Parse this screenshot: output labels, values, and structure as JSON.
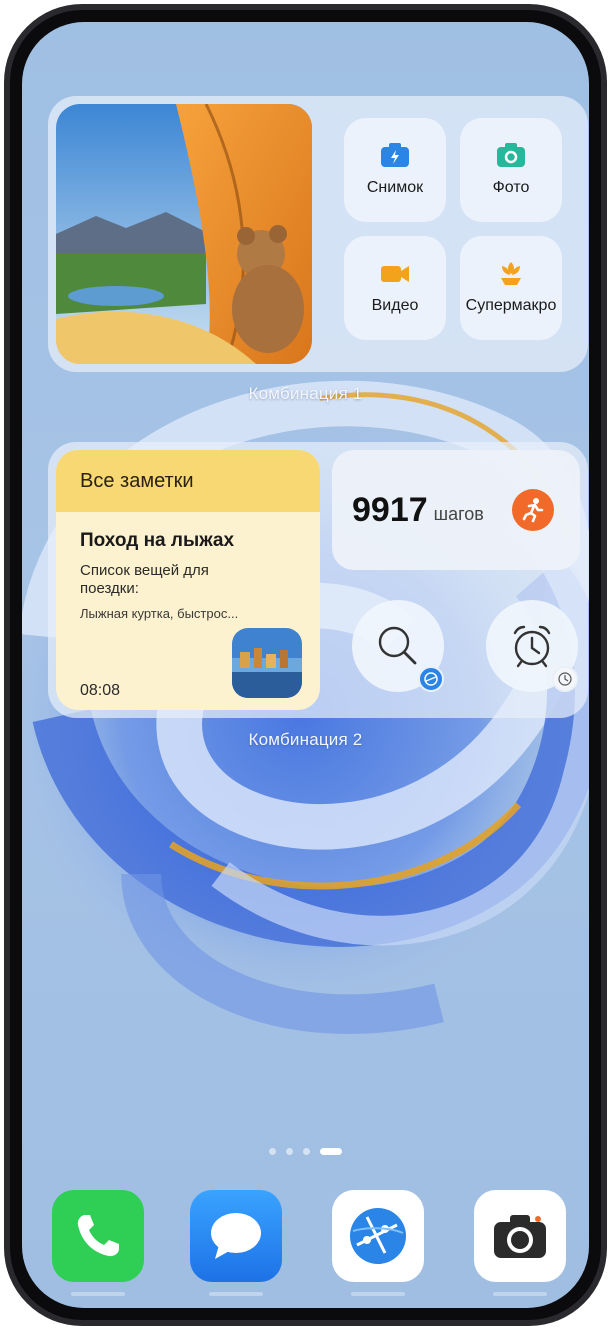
{
  "combo1": {
    "label": "Комбинация 1",
    "buttons": [
      {
        "label": "Снимок",
        "icon": "camera-bolt-icon"
      },
      {
        "label": "Фото",
        "icon": "photo-camera-icon"
      },
      {
        "label": "Видео",
        "icon": "video-camera-icon"
      },
      {
        "label": "Супермакро",
        "icon": "flower-macro-icon"
      }
    ]
  },
  "combo2": {
    "label": "Комбинация 2",
    "notes": {
      "header": "Все заметки",
      "title": "Поход на лыжах",
      "subtitle": "Список вещей для поездки:",
      "line": "Лыжная куртка, быстрос...",
      "time": "08:08"
    },
    "steps": {
      "value": "9917",
      "unit": "шагов",
      "icon": "running-person-icon"
    },
    "tools": [
      {
        "icon": "search-icon",
        "badge_icon": "browser-icon"
      },
      {
        "icon": "alarm-clock-icon",
        "badge_icon": "clock-icon"
      }
    ]
  },
  "pager": {
    "pages": 4,
    "active_index": 3
  },
  "dock": [
    {
      "name": "phone",
      "icon": "phone-icon",
      "color": "#2fcf55"
    },
    {
      "name": "messages",
      "icon": "message-icon",
      "color": "#2a8cf2"
    },
    {
      "name": "browser",
      "icon": "browser-icon",
      "color": "#ffffff"
    },
    {
      "name": "camera",
      "icon": "camera-icon",
      "color": "#ffffff"
    }
  ],
  "colors": {
    "notes_header": "#f8d873",
    "notes_body": "#fdf2cf",
    "steps_badge": "#f26a2a",
    "accent_blue": "#2b85e6"
  }
}
